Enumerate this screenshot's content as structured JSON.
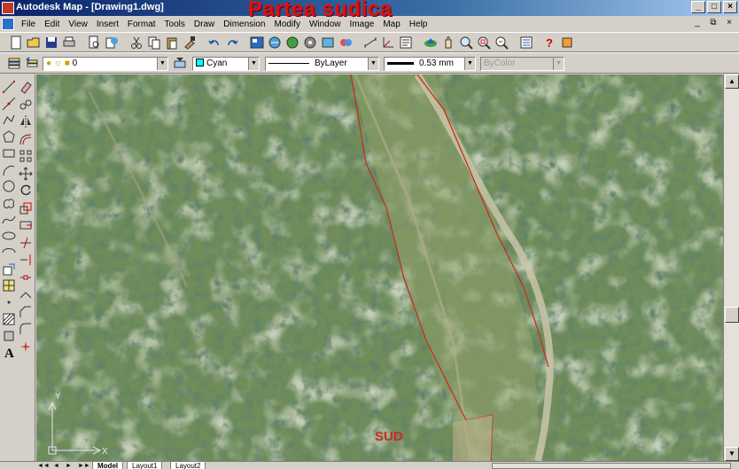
{
  "window": {
    "title": "Autodesk Map - [Drawing1.dwg]",
    "overlay_title": "Partea sudica",
    "buttons": {
      "minimize": "_",
      "maximize": "□",
      "close": "×"
    }
  },
  "menu": {
    "items": [
      "File",
      "Edit",
      "View",
      "Insert",
      "Format",
      "Tools",
      "Draw",
      "Dimension",
      "Modify",
      "Window",
      "Image",
      "Map",
      "Help"
    ],
    "doc_buttons": {
      "minimize": "_",
      "restore": "⧉",
      "close": "×"
    }
  },
  "properties": {
    "layer": "0",
    "color": "Cyan",
    "color_hex": "#00ffff",
    "linetype": "ByLayer",
    "lineweight": "0.53 mm",
    "plotstyle": "ByColor"
  },
  "drawing": {
    "label": "SUD",
    "boundary_color": "#c43020",
    "ucs": {
      "y": "Y",
      "x": "X"
    }
  },
  "tabs": {
    "nav": [
      "◄◄",
      "◄",
      "►",
      "►►"
    ],
    "items": [
      "Model",
      "Layout1",
      "Layout2"
    ],
    "active": "Model"
  },
  "icons": {
    "standard_toolbar": [
      "new-icon",
      "open-icon",
      "save-icon",
      "print-icon",
      "plot-preview-icon",
      "publish-icon",
      "cut-icon",
      "copy-icon",
      "paste-icon",
      "matchprop-icon",
      "undo-icon",
      "redo-icon",
      "design-center-icon",
      "hyperlink-icon",
      "3d-orbit-icon",
      "toolpalettes-icon",
      "sheetset-icon",
      "markup-icon",
      "distance-icon",
      "ucs-icon",
      "named-views-icon",
      "map-icon",
      "pan-icon",
      "zoom-realtime-icon",
      "zoom-window-icon",
      "zoom-previous-icon",
      "properties-icon",
      "help-icon",
      "bulb-icon"
    ],
    "draw_toolbar": [
      "line-icon",
      "construction-line-icon",
      "polyline-icon",
      "polygon-icon",
      "rectangle-icon",
      "arc-icon",
      "circle-icon",
      "revision-cloud-icon",
      "spline-icon",
      "ellipse-icon",
      "ellipse-arc-icon",
      "insert-block-icon",
      "make-block-icon",
      "point-icon",
      "hatch-icon",
      "region-icon",
      "text-icon"
    ],
    "modify_toolbar": [
      "erase-icon",
      "copy-object-icon",
      "mirror-icon",
      "offset-icon",
      "array-icon",
      "move-icon",
      "rotate-icon",
      "scale-icon",
      "stretch-icon",
      "trim-icon",
      "extend-icon",
      "break-icon",
      "join-icon",
      "chamfer-icon",
      "fillet-icon",
      "explode-icon"
    ]
  }
}
